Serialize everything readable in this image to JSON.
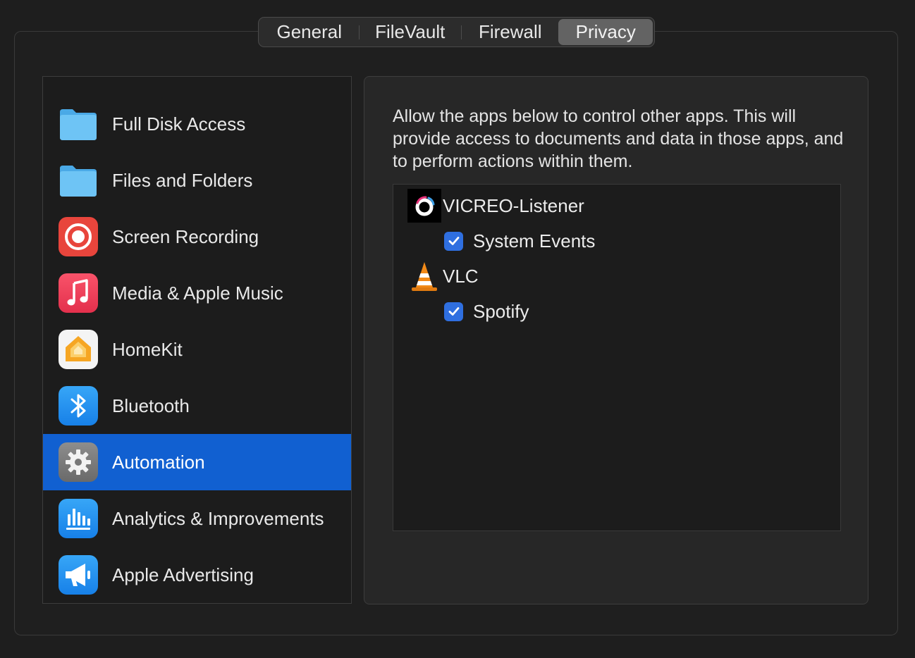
{
  "tabs": [
    {
      "label": "General",
      "selected": false
    },
    {
      "label": "FileVault",
      "selected": false
    },
    {
      "label": "Firewall",
      "selected": false
    },
    {
      "label": "Privacy",
      "selected": true
    }
  ],
  "sidebar": {
    "items": [
      {
        "label": "Full Disk Access",
        "icon": "folder-icon"
      },
      {
        "label": "Files and Folders",
        "icon": "folder-icon"
      },
      {
        "label": "Screen Recording",
        "icon": "record-icon"
      },
      {
        "label": "Media & Apple Music",
        "icon": "music-note-icon"
      },
      {
        "label": "HomeKit",
        "icon": "home-icon"
      },
      {
        "label": "Bluetooth",
        "icon": "bluetooth-icon"
      },
      {
        "label": "Automation",
        "icon": "gear-icon",
        "selected": true
      },
      {
        "label": "Analytics & Improvements",
        "icon": "chart-bars-icon"
      },
      {
        "label": "Apple Advertising",
        "icon": "megaphone-icon"
      }
    ]
  },
  "content": {
    "description": "Allow the apps below to control other apps. This will provide access to documents and data in those apps, and to perform actions within them.",
    "apps": [
      {
        "name": "VICREO-Listener",
        "icon": "vicreo-icon",
        "permissions": [
          {
            "name": "System Events",
            "checked": true
          }
        ]
      },
      {
        "name": "VLC",
        "icon": "vlc-cone-icon",
        "permissions": [
          {
            "name": "Spotify",
            "checked": true
          }
        ]
      }
    ]
  },
  "colors": {
    "selection": "#1160d1",
    "checkbox": "#2f6fe0",
    "tab_selected": "#636363"
  }
}
